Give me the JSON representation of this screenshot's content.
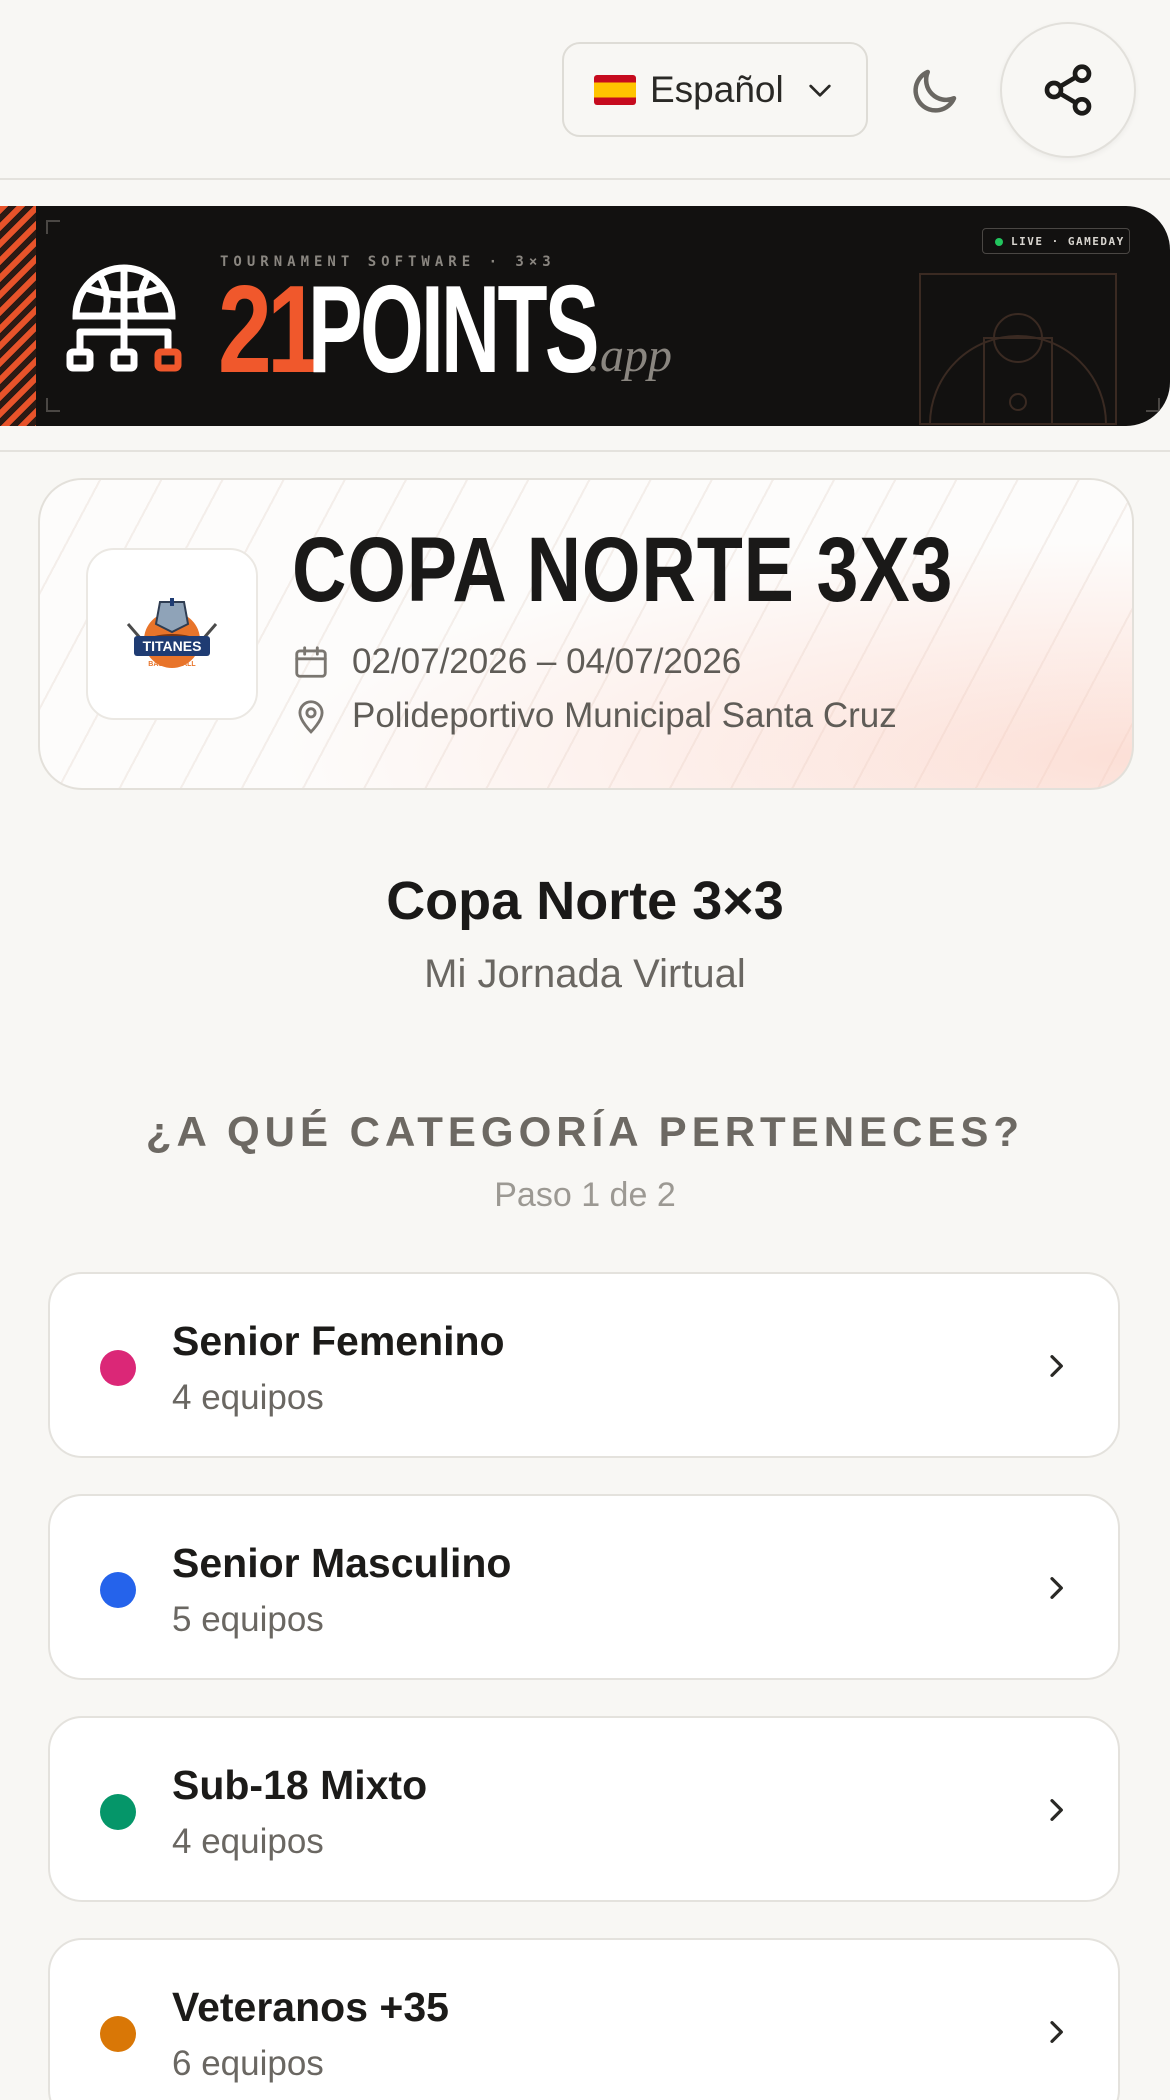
{
  "header": {
    "language": "Español",
    "theme_toggle_icon": "moon-icon",
    "share_icon": "share-icon"
  },
  "banner": {
    "tagline": "TOURNAMENT SOFTWARE · 3×3",
    "logo_number": "21",
    "logo_word": "POINTS",
    "logo_suffix": ".app",
    "live_label": "LIVE · GAMEDAY"
  },
  "tournament": {
    "name": "COPA NORTE 3X3",
    "logo_text": "TITANES",
    "logo_subtext": "BASKETBALL",
    "dates": "02/07/2026 – 04/07/2026",
    "venue": "Polideportivo Municipal Santa Cruz"
  },
  "page": {
    "title": "Copa Norte 3×3",
    "subtitle": "Mi Jornada Virtual",
    "question": "¿A QUÉ CATEGORÍA PERTENECES?",
    "step": "Paso 1 de 2"
  },
  "categories": [
    {
      "name": "Senior Femenino",
      "count": "4 equipos",
      "color": "#db2777"
    },
    {
      "name": "Senior Masculino",
      "count": "5 equipos",
      "color": "#2563eb"
    },
    {
      "name": "Sub-18 Mixto",
      "count": "4 equipos",
      "color": "#059669"
    },
    {
      "name": "Veteranos +35",
      "count": "6 equipos",
      "color": "#d97706"
    }
  ],
  "colors": {
    "accent": "#f0582c",
    "background": "#f8f7f4"
  }
}
